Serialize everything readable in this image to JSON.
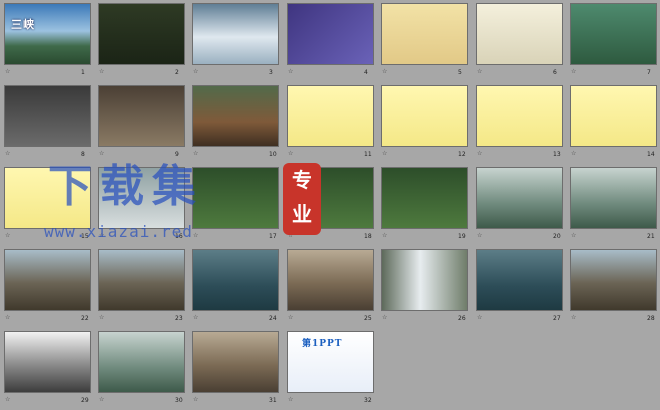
{
  "slides": [
    {
      "num": "1",
      "style": "sky",
      "title": "三峡"
    },
    {
      "num": "2",
      "style": "yellow-text"
    },
    {
      "num": "3",
      "style": "snow"
    },
    {
      "num": "4",
      "style": "purple"
    },
    {
      "num": "5",
      "style": "map"
    },
    {
      "num": "6",
      "style": "map2"
    },
    {
      "num": "7",
      "style": "green"
    },
    {
      "num": "8",
      "style": "poem"
    },
    {
      "num": "9",
      "style": "poem2"
    },
    {
      "num": "10",
      "style": "gorge"
    },
    {
      "num": "11",
      "style": "yellow-card"
    },
    {
      "num": "12",
      "style": "yellow-card"
    },
    {
      "num": "13",
      "style": "yellow-card"
    },
    {
      "num": "14",
      "style": "yellow-card"
    },
    {
      "num": "15",
      "style": "yellow-card"
    },
    {
      "num": "16",
      "style": "foggy"
    },
    {
      "num": "17",
      "style": "dark-green"
    },
    {
      "num": "18",
      "style": "dark-green"
    },
    {
      "num": "19",
      "style": "dark-green"
    },
    {
      "num": "20",
      "style": "valley"
    },
    {
      "num": "21",
      "style": "valley"
    },
    {
      "num": "22",
      "style": "cliff"
    },
    {
      "num": "23",
      "style": "cliff"
    },
    {
      "num": "24",
      "style": "river"
    },
    {
      "num": "25",
      "style": "rock"
    },
    {
      "num": "26",
      "style": "waterfall"
    },
    {
      "num": "27",
      "style": "river"
    },
    {
      "num": "28",
      "style": "cliff"
    },
    {
      "num": "29",
      "style": "peaks"
    },
    {
      "num": "30",
      "style": "valley"
    },
    {
      "num": "31",
      "style": "rock"
    },
    {
      "num": "32",
      "style": "ad",
      "title": "第1PPT"
    }
  ],
  "watermark": {
    "main": "下载集",
    "url": "www.xiazai.red",
    "stamp": [
      "专",
      "业"
    ]
  },
  "colors": {
    "bg": "#a7a7a7",
    "watermark": "#2850be",
    "stamp": "#c8342a"
  }
}
